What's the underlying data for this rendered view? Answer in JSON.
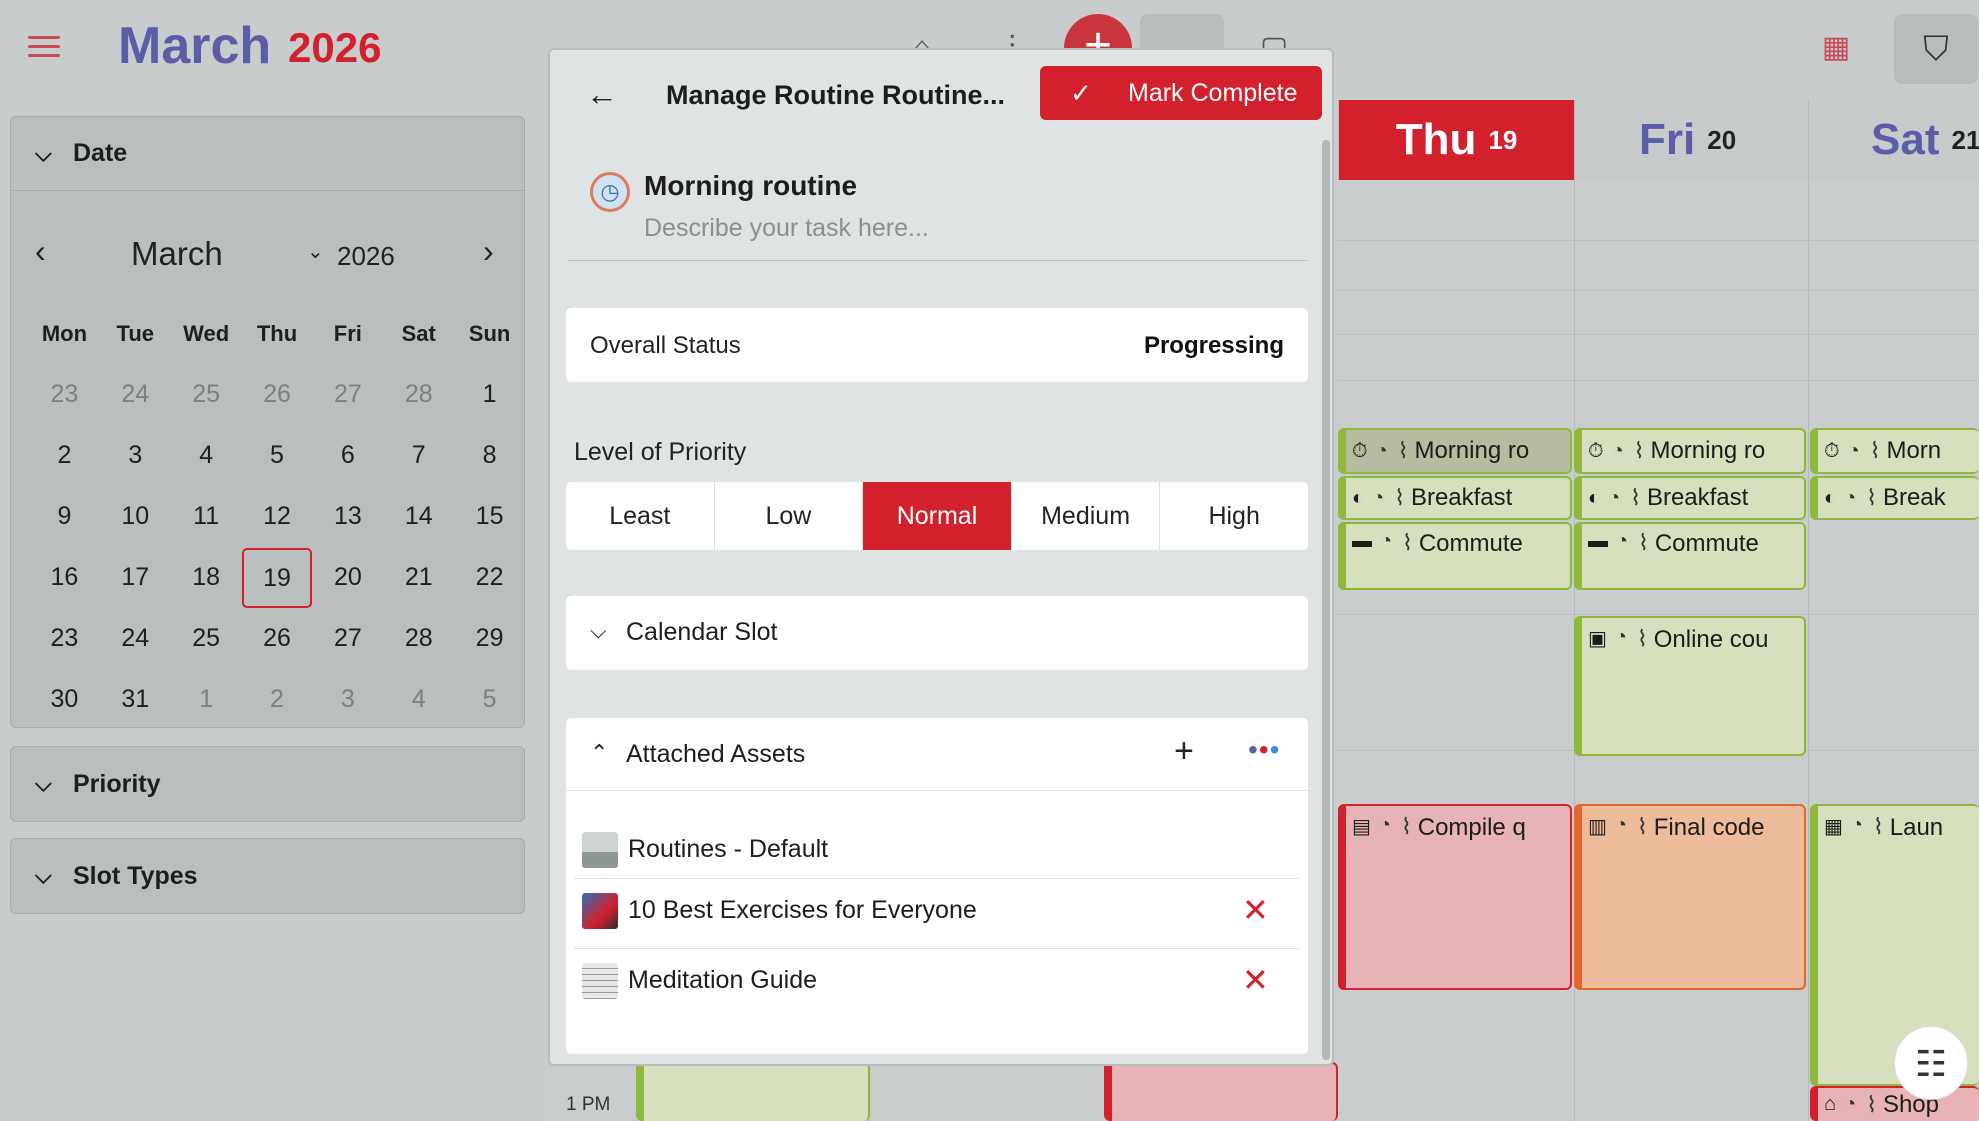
{
  "header": {
    "month": "March",
    "year": "2026"
  },
  "sidebar": {
    "date_section": "Date",
    "priority_section": "Priority",
    "slot_types_section": "Slot Types",
    "mini_calendar": {
      "month": "March",
      "year": "2026",
      "weekdays": [
        "Mon",
        "Tue",
        "Wed",
        "Thu",
        "Fri",
        "Sat",
        "Sun"
      ],
      "weeks": [
        [
          "23",
          "24",
          "25",
          "26",
          "27",
          "28",
          "1"
        ],
        [
          "2",
          "3",
          "4",
          "5",
          "6",
          "7",
          "8"
        ],
        [
          "9",
          "10",
          "11",
          "12",
          "13",
          "14",
          "15"
        ],
        [
          "16",
          "17",
          "18",
          "19",
          "20",
          "21",
          "22"
        ],
        [
          "23",
          "24",
          "25",
          "26",
          "27",
          "28",
          "29"
        ],
        [
          "30",
          "31",
          "1",
          "2",
          "3",
          "4",
          "5"
        ]
      ],
      "selected_day": "19"
    }
  },
  "calendar": {
    "days": [
      {
        "name": "Thu",
        "date": "19"
      },
      {
        "name": "Fri",
        "date": "20"
      },
      {
        "name": "Sat",
        "date": "21"
      }
    ],
    "events": {
      "thu": [
        "Morning ro",
        "Breakfast",
        "Commute",
        "Compile q"
      ],
      "fri": [
        "Morning ro",
        "Breakfast",
        "Commute",
        "Online cou",
        "Final code"
      ],
      "sat": [
        "Morn",
        "Break",
        "Laun",
        "Shop"
      ]
    },
    "time_label": "1 PM"
  },
  "modal": {
    "title": "Manage Routine Routine...",
    "mark_complete": "Mark Complete",
    "task_name": "Morning routine",
    "task_placeholder": "Describe your task here...",
    "status_label": "Overall Status",
    "status_value": "Progressing",
    "priority_label": "Level of Priority",
    "priority_options": [
      "Least",
      "Low",
      "Normal",
      "Medium",
      "High"
    ],
    "priority_selected": "Normal",
    "calendar_slot_label": "Calendar Slot",
    "attached_assets_label": "Attached Assets",
    "assets": [
      {
        "name": "Routines - Default",
        "removable": false
      },
      {
        "name": "10 Best Exercises for Everyone",
        "removable": true
      },
      {
        "name": "Meditation Guide",
        "removable": true
      }
    ]
  },
  "colors": {
    "accent_red": "#d2202c",
    "brand_purple": "#5b5ea6",
    "event_green": "#d6e0bf",
    "event_red": "#e7b3b6",
    "event_orange": "#eebb9b"
  },
  "icons": [
    "menu-icon",
    "home-icon",
    "sliders-icon",
    "plus-icon",
    "calendar-icon",
    "square-icon",
    "calendar-today-icon",
    "filter-icon",
    "back-arrow-icon",
    "check-icon",
    "stopwatch-icon",
    "chevron-down-icon",
    "chevron-up-icon",
    "plus-icon",
    "more-dots-icon",
    "close-icon",
    "notes-icon"
  ]
}
